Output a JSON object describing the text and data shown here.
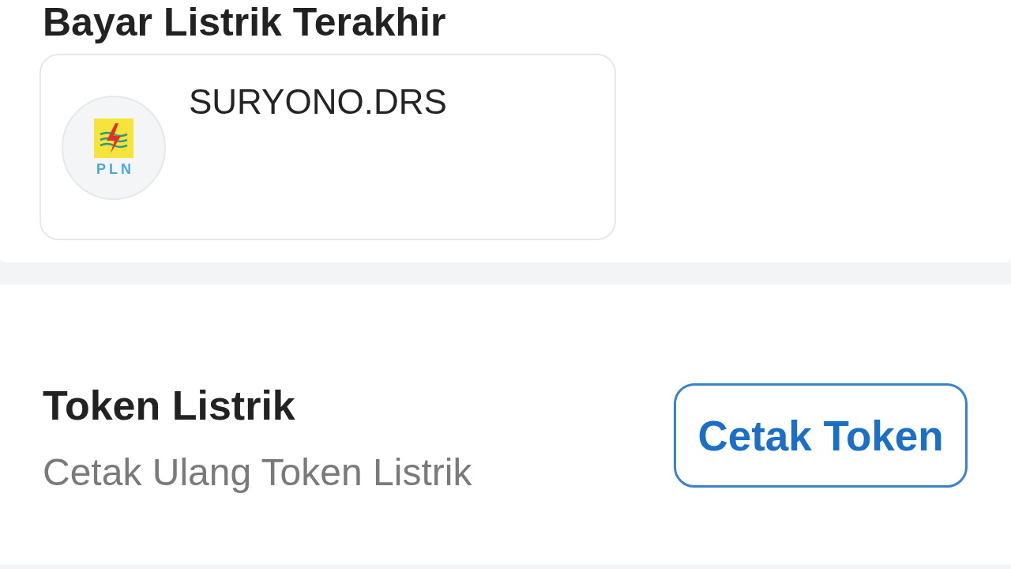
{
  "last_payment": {
    "title": "Bayar Listrik Terakhir",
    "items": [
      {
        "logo_text": "PLN",
        "name": "SURYONO.DRS"
      }
    ]
  },
  "token": {
    "title": "Token Listrik",
    "subtitle": "Cetak Ulang Token Listrik",
    "button": "Cetak Token"
  }
}
